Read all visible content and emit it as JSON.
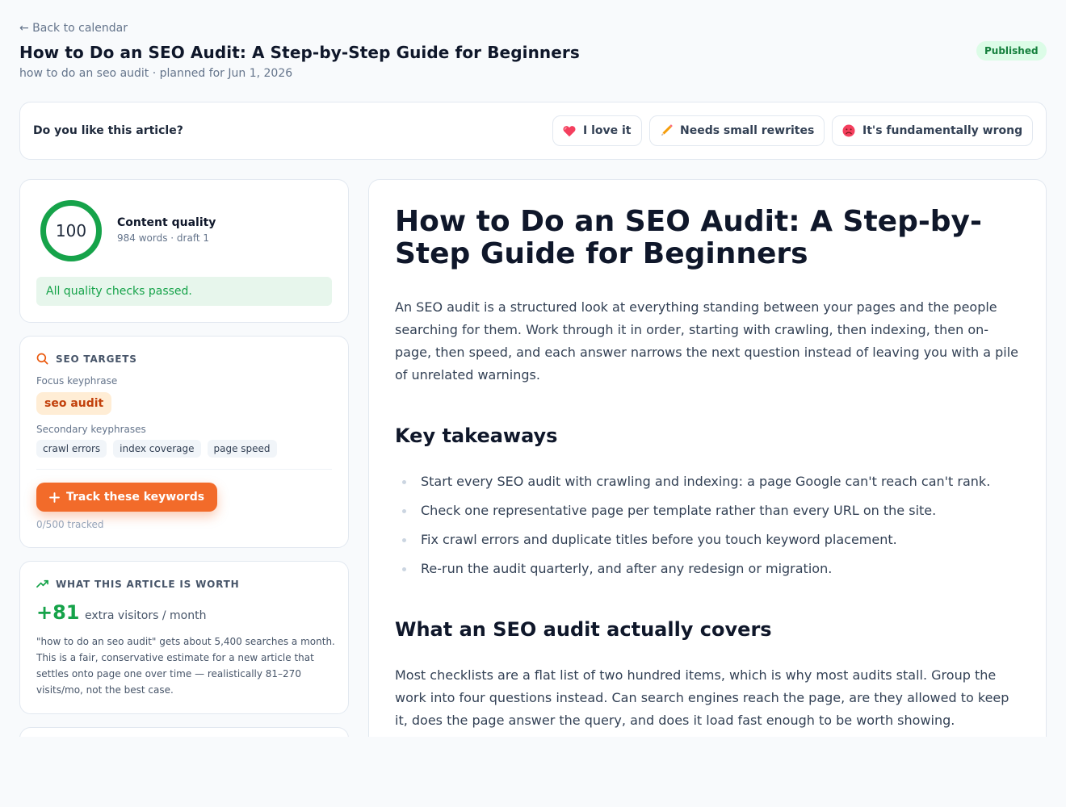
{
  "header": {
    "back_link": "← Back to calendar",
    "title": "How to Do an SEO Audit: A Step-by-Step Guide for Beginners",
    "subtitle": "how to do an seo audit · planned for Jun 1, 2026",
    "status": "Published",
    "status_color": "#15803d"
  },
  "feedback": {
    "question": "Do you like this article?",
    "options": [
      {
        "label": "I love it",
        "icon": "heart-icon"
      },
      {
        "label": "Needs small rewrites",
        "icon": "pencil-icon"
      },
      {
        "label": "It's fundamentally wrong",
        "icon": "sad-face-icon"
      }
    ]
  },
  "quality": {
    "score": "100",
    "score_fraction": 1.0,
    "title": "Content quality",
    "meta": "984 words · draft 1",
    "message": "All quality checks passed.",
    "ring_color": "#16a34a"
  },
  "seo_targets": {
    "heading": "SEO TARGETS",
    "icon": "search-icon",
    "focus_label": "Focus keyphrase",
    "focus": "seo audit",
    "secondary_label": "Secondary keyphrases",
    "secondary": [
      "crawl errors",
      "index coverage",
      "page speed"
    ],
    "button": "Track these keywords",
    "tracked": "0/500 tracked",
    "accent": "#f26b2a"
  },
  "worth": {
    "heading": "WHAT THIS ARTICLE IS WORTH",
    "icon": "trending-up-icon",
    "value": "+81",
    "unit": "extra visitors / month",
    "description": "\"how to do an seo audit\" gets about 5,400 searches a month. This is a fair, conservative estimate for a new article that settles onto page one over time — realistically 81–270 visits/mo, not the best case."
  },
  "article": {
    "title": "How to Do an SEO Audit: A Step-by-Step Guide for Beginners",
    "intro": "An SEO audit is a structured look at everything standing between your pages and the people searching for them. Work through it in order, starting with crawling, then indexing, then on-page, then speed, and each answer narrows the next question instead of leaving you with a pile of unrelated warnings.",
    "h2_takeaways": "Key takeaways",
    "takeaways": [
      "Start every SEO audit with crawling and indexing: a page Google can't reach can't rank.",
      "Check one representative page per template rather than every URL on the site.",
      "Fix crawl errors and duplicate titles before you touch keyword placement.",
      "Re-run the audit quarterly, and after any redesign or migration."
    ],
    "h2_covers": "What an SEO audit actually covers",
    "covers_para": "Most checklists are a flat list of two hundred items, which is why most audits stall. Group the work into four questions instead. Can search engines reach the page, are they allowed to keep it, does the page answer the query, and does it load fast enough to be worth showing."
  }
}
